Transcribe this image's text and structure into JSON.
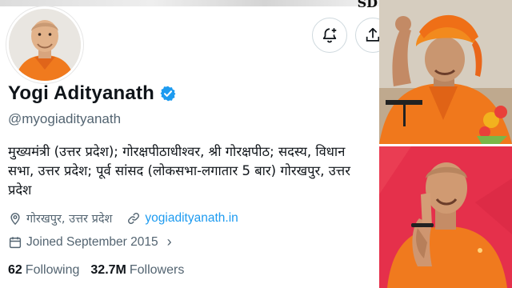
{
  "banner": {
    "mark": "SD"
  },
  "profile": {
    "name": "Yogi Adityanath",
    "handle": "@myogiadityanath",
    "bio_lines": [
      "मुख्यमंत्री (उत्तर प्रदेश); गोरक्षपीठाधीश्वर, श्री गोरक्षपीठ; सदस्य, विधान",
      "सभा, उत्तर प्रदेश; पूर्व सांसद (लोकसभा-लगातार 5 बार) गोरखपुर, उत्तर",
      "प्रदेश"
    ],
    "location": "गोरखपुर, उत्तर प्रदेश",
    "website": "yogiadityanath.in",
    "joined": "Joined September 2015",
    "joined_chevron": "›",
    "following_count": "62",
    "following_label": "Following",
    "followers_count": "32.7M",
    "followers_label": "Followers"
  },
  "icons": {
    "verified": "verified-badge-icon",
    "notify": "bell-plus-icon",
    "share": "share-upload-icon",
    "location": "location-pin-icon",
    "link": "link-icon",
    "calendar": "calendar-icon"
  },
  "colors": {
    "accent_blue": "#1d9bf0",
    "text_primary": "#0f1419",
    "text_secondary": "#536471",
    "saffron": "#f07a1e",
    "photo_red_bg": "#e5304b"
  }
}
